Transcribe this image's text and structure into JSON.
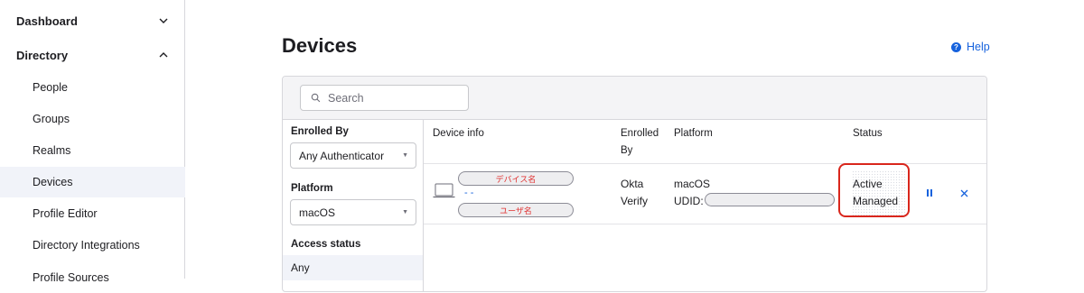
{
  "sidebar": {
    "sections": [
      {
        "label": "Dashboard",
        "expanded": false
      },
      {
        "label": "Directory",
        "expanded": true
      }
    ],
    "items": [
      {
        "label": "People"
      },
      {
        "label": "Groups"
      },
      {
        "label": "Realms"
      },
      {
        "label": "Devices",
        "active": true
      },
      {
        "label": "Profile Editor"
      },
      {
        "label": "Directory Integrations"
      },
      {
        "label": "Profile Sources"
      }
    ]
  },
  "page": {
    "title": "Devices",
    "help_label": "Help",
    "help_icon": "?"
  },
  "search": {
    "placeholder": "Search",
    "value": ""
  },
  "filters": {
    "enrolled_by": {
      "label": "Enrolled By",
      "selected": "Any Authenticator"
    },
    "platform": {
      "label": "Platform",
      "selected": "macOS"
    },
    "access_status": {
      "label": "Access status",
      "selected_option": "Any"
    }
  },
  "table": {
    "columns": {
      "device_info": "Device info",
      "enrolled_by_line1": "Enrolled",
      "enrolled_by_line2": "By",
      "platform": "Platform",
      "status": "Status"
    },
    "rows": [
      {
        "device_name_redacted": "デバイス名",
        "device_sub": "- -",
        "user_name_redacted": "ユーザ名",
        "enrolled_by_line1": "Okta",
        "enrolled_by_line2": "Verify",
        "platform": "macOS",
        "udid_label": "UDID:",
        "status_line1": "Active",
        "status_line2": "Managed"
      }
    ]
  },
  "colors": {
    "accent": "#1662dd",
    "annotation_red": "#d9261c",
    "redaction_text": "#e03030"
  }
}
